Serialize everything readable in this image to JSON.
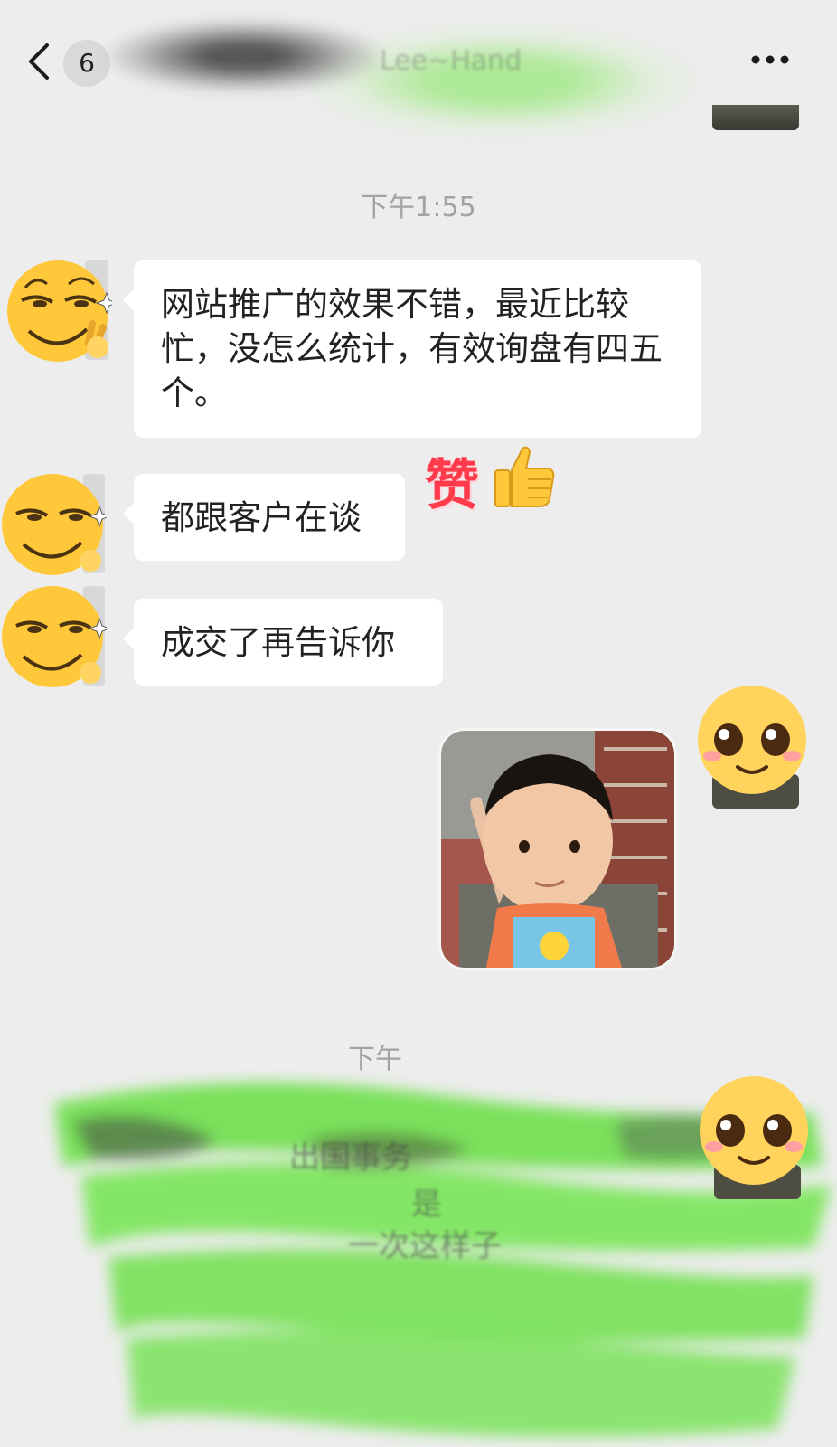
{
  "header": {
    "back_icon": "chevron-left-icon",
    "unread_count": "6",
    "title": "Lee~Hand",
    "more_icon": "more-dots-icon"
  },
  "timestamps": [
    "下午1:55",
    "下午"
  ],
  "messages": [
    {
      "from": "contact",
      "type": "text",
      "text": "网站推广的效果不错，最近比较忙，没怎么统计，有效询盘有四五个。"
    },
    {
      "from": "contact",
      "type": "text",
      "text": "都跟客户在谈"
    },
    {
      "from": "contact",
      "type": "text",
      "text": "成交了再告诉你"
    },
    {
      "from": "me",
      "type": "sticker",
      "sticker": "waving-toddler-sticker"
    }
  ],
  "overlay": {
    "zan_text": "赞",
    "zan_icon": "thumbs-up-icon"
  },
  "redacted_fragments": [
    "出国事务",
    "一次这样子",
    "是"
  ],
  "colors": {
    "background": "#ededed",
    "bubble": "#ffffff",
    "zan": "#ff3b4b",
    "redaction_green": "#6ee04a"
  }
}
